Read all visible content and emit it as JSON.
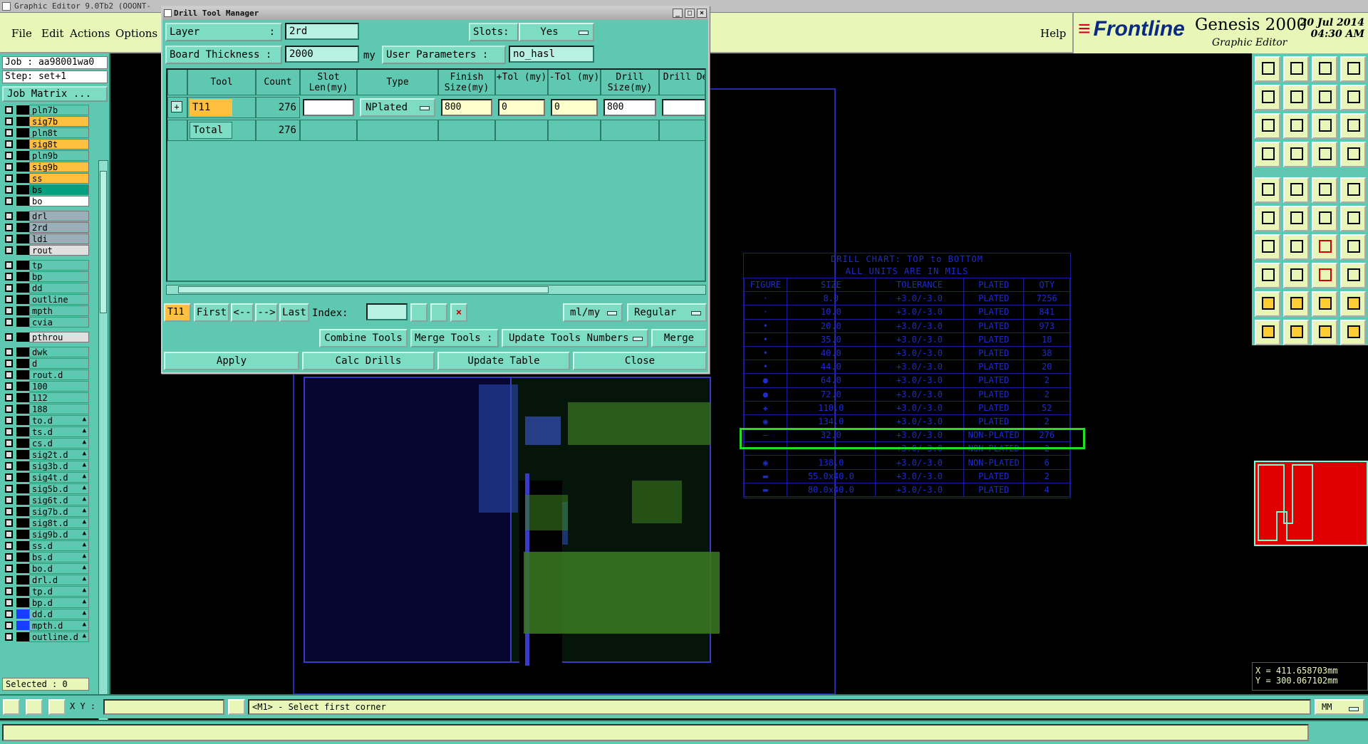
{
  "titlebar": {
    "text": "Graphic Editor 9.0Tb2  (OOONT-"
  },
  "menu": {
    "file": "File",
    "edit": "Edit",
    "actions": "Actions",
    "options": "Options",
    "help": "Help"
  },
  "brand": {
    "logo": "Frontline",
    "product": "Genesis 2000",
    "subtitle": "Graphic Editor",
    "date": "20 Jul 2014",
    "time": "04:30 AM"
  },
  "left": {
    "job": "Job : aa98001wa0",
    "step": "Step: set+1",
    "job_matrix": "Job Matrix ...",
    "selected": "Selected : 0",
    "layers": [
      {
        "name": "pln7b",
        "color": "#5fc8b0"
      },
      {
        "name": "sig7b",
        "color": "#ffc040"
      },
      {
        "name": "pln8t",
        "color": "#5fc8b0"
      },
      {
        "name": "sig8t",
        "color": "#ffc040"
      },
      {
        "name": "pln9b",
        "color": "#5fc8b0"
      },
      {
        "name": "sig9b",
        "color": "#ffc040"
      },
      {
        "name": "ss",
        "color": "#ffc040"
      },
      {
        "name": "bs",
        "color": "#00a080"
      },
      {
        "name": "bo",
        "color": "#ffffff"
      },
      {
        "name": "drl",
        "color": "#9ab0b8"
      },
      {
        "name": "2rd",
        "color": "#9ab0b8"
      },
      {
        "name": "ldi",
        "color": "#9ab0b8"
      },
      {
        "name": "rout",
        "color": "#e0e0e0"
      },
      {
        "name": "tp",
        "color": "#5fc8b0"
      },
      {
        "name": "bp",
        "color": "#5fc8b0"
      },
      {
        "name": "dd",
        "color": "#5fc8b0"
      },
      {
        "name": "outline",
        "color": "#5fc8b0"
      },
      {
        "name": "mpth",
        "color": "#5fc8b0"
      },
      {
        "name": "cvia",
        "color": "#5fc8b0"
      },
      {
        "name": "pthrou",
        "color": "#e0e0e0"
      },
      {
        "name": "dwk",
        "color": "#5fc8b0"
      },
      {
        "name": "d",
        "color": "#5fc8b0"
      },
      {
        "name": "rout.d",
        "color": "#5fc8b0"
      },
      {
        "name": "100",
        "color": "#5fc8b0"
      },
      {
        "name": "112",
        "color": "#5fc8b0"
      },
      {
        "name": "188",
        "color": "#5fc8b0"
      },
      {
        "name": "to.d",
        "color": "#5fc8b0"
      },
      {
        "name": "ts.d",
        "color": "#5fc8b0"
      },
      {
        "name": "cs.d",
        "color": "#5fc8b0"
      },
      {
        "name": "sig2t.d",
        "color": "#5fc8b0"
      },
      {
        "name": "sig3b.d",
        "color": "#5fc8b0"
      },
      {
        "name": "sig4t.d",
        "color": "#5fc8b0"
      },
      {
        "name": "sig5b.d",
        "color": "#5fc8b0"
      },
      {
        "name": "sig6t.d",
        "color": "#5fc8b0"
      },
      {
        "name": "sig7b.d",
        "color": "#5fc8b0"
      },
      {
        "name": "sig8t.d",
        "color": "#5fc8b0"
      },
      {
        "name": "sig9b.d",
        "color": "#5fc8b0"
      },
      {
        "name": "ss.d",
        "color": "#5fc8b0"
      },
      {
        "name": "bs.d",
        "color": "#5fc8b0"
      },
      {
        "name": "bo.d",
        "color": "#5fc8b0"
      },
      {
        "name": "drl.d",
        "color": "#5fc8b0"
      },
      {
        "name": "tp.d",
        "color": "#5fc8b0"
      },
      {
        "name": "bp.d",
        "color": "#5fc8b0"
      },
      {
        "name": "dd.d",
        "color": "#5fc8b0"
      },
      {
        "name": "mpth.d",
        "color": "#5fc8b0"
      },
      {
        "name": "outline.d",
        "color": "#5fc8b0"
      }
    ]
  },
  "dtm": {
    "title": "Drill Tool Manager",
    "layer_label": "Layer",
    "layer_sep": ":",
    "layer_value": "2rd",
    "slots_label": "Slots:",
    "slots_value": "Yes",
    "thickness_label": "Board Thickness :",
    "thickness_value": "2000",
    "thickness_unit": "my",
    "user_params_label": "User Parameters :",
    "user_params_value": "no_hasl",
    "headers": {
      "tool": "Tool",
      "count": "Count",
      "slot": "Slot Len(my)",
      "type": "Type",
      "finish": "Finish Size(my)",
      "ptol": "+Tol (my)",
      "mtol": "-Tol (my)",
      "drill": "Drill Size(my)",
      "des": "Drill Des"
    },
    "row": {
      "tool": "T11",
      "count": "276",
      "type": "NPlated",
      "finish": "800",
      "ptol": "0",
      "mtol": "0",
      "drill": "800"
    },
    "total": {
      "label": "Total",
      "count": "276"
    },
    "nav": {
      "current": "T11",
      "first": "First",
      "prev": "<--",
      "next": "-->",
      "last": "Last",
      "index": "Index:",
      "units": "ml/my",
      "mode": "Regular"
    },
    "actions": {
      "combine": "Combine Tools",
      "merge_tools": "Merge Tools :",
      "update_numbers": "Update Tools Numbers",
      "merge": "Merge"
    },
    "buttons": {
      "apply": "Apply",
      "calc": "Calc Drills",
      "update": "Update Table",
      "close": "Close"
    }
  },
  "drill_chart": {
    "title1": "DRILL CHART: TOP to BOTTOM",
    "title2": "ALL UNITS ARE IN MILS",
    "headers": [
      "FIGURE",
      "SIZE",
      "TOLERANCE",
      "PLATED",
      "QTY"
    ],
    "rows": [
      [
        "·",
        "8.0",
        "+3.0/-3.0",
        "PLATED",
        "7256"
      ],
      [
        "·",
        "10.0",
        "+3.0/-3.0",
        "PLATED",
        "841"
      ],
      [
        "•",
        "20.0",
        "+3.0/-3.0",
        "PLATED",
        "973"
      ],
      [
        "•",
        "35.0",
        "+3.0/-3.0",
        "PLATED",
        "18"
      ],
      [
        "•",
        "40.0",
        "+3.0/-3.0",
        "PLATED",
        "38"
      ],
      [
        "•",
        "44.0",
        "+3.0/-3.0",
        "PLATED",
        "20"
      ],
      [
        "●",
        "64.0",
        "+3.0/-3.0",
        "PLATED",
        "2"
      ],
      [
        "●",
        "72.0",
        "+3.0/-3.0",
        "PLATED",
        "2"
      ],
      [
        "✚",
        "110.0",
        "+3.0/-3.0",
        "PLATED",
        "52"
      ],
      [
        "◉",
        "134.0",
        "+3.0/-3.0",
        "PLATED",
        "2"
      ],
      [
        "—",
        "32.0",
        "+3.0/-3.0",
        "NON-PLATED",
        "276"
      ],
      [
        "",
        "",
        "+3.0/-3.0",
        "NON-PLATED",
        "2"
      ],
      [
        "◉",
        "138.0",
        "+3.0/-3.0",
        "NON-PLATED",
        "6"
      ],
      [
        "▬",
        "55.0x40.0",
        "+3.0/-3.0",
        "PLATED",
        "2"
      ],
      [
        "▬",
        "80.0x40.0",
        "+3.0/-3.0",
        "PLATED",
        "4"
      ]
    ]
  },
  "status": {
    "xy_label": "X Y :",
    "message": "<M1> - Select first corner",
    "unit": "MM"
  },
  "coords": {
    "x": "X = 411.658703mm",
    "y": "Y = 300.067102mm"
  }
}
